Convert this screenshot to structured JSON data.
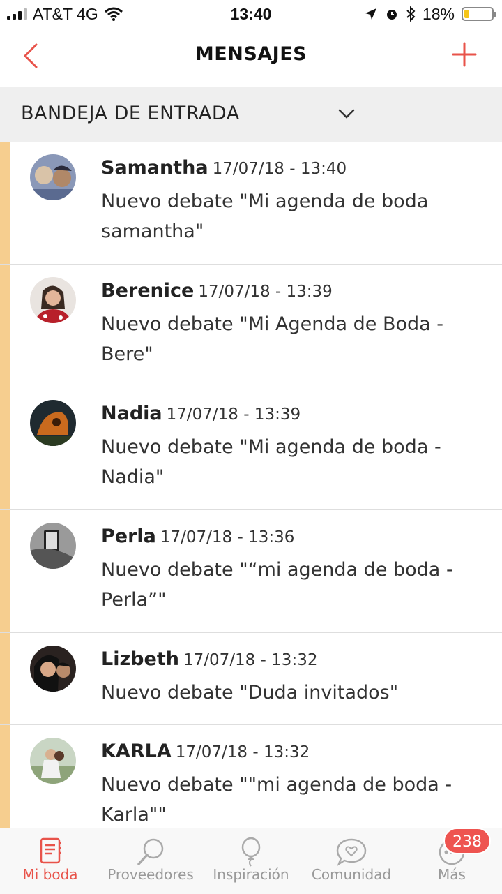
{
  "status_bar": {
    "carrier": "AT&T 4G",
    "time": "13:40",
    "battery": "18%",
    "battery_level": 0.18
  },
  "header": {
    "title": "MENSAJES",
    "back_icon": "chevron-left-icon",
    "add_icon": "plus-icon",
    "accent_color": "#e8534a"
  },
  "folder": {
    "label": "BANDEJA DE ENTRADA"
  },
  "messages": [
    {
      "name": "Samantha",
      "date": "17/07/18 - 13:40",
      "text": "Nuevo debate \"Mi agenda de boda samantha\""
    },
    {
      "name": "Berenice",
      "date": "17/07/18 - 13:39",
      "text": "Nuevo debate \"Mi Agenda de Boda - Bere\""
    },
    {
      "name": "Nadia",
      "date": "17/07/18 - 13:39",
      "text": "Nuevo debate \"Mi agenda de boda - Nadia\""
    },
    {
      "name": "Perla",
      "date": "17/07/18 - 13:36",
      "text": "Nuevo debate \"“mi agenda de boda - Perla”\""
    },
    {
      "name": "Lizbeth",
      "date": "17/07/18 - 13:32",
      "text": "Nuevo debate \"Duda invitados\""
    },
    {
      "name": "KARLA",
      "date": "17/07/18 - 13:32",
      "text": "Nuevo debate \"\"mi agenda de boda - Karla\"\""
    }
  ],
  "tabs": [
    {
      "label": "Mi boda",
      "icon": "planner-book-icon",
      "active": true
    },
    {
      "label": "Proveedores",
      "icon": "magnifier-icon",
      "active": false
    },
    {
      "label": "Inspiración",
      "icon": "balloon-icon",
      "active": false
    },
    {
      "label": "Comunidad",
      "icon": "chat-heart-icon",
      "active": false
    },
    {
      "label": "Más",
      "icon": "more-icon",
      "active": false
    }
  ],
  "more_badge": "238",
  "colors": {
    "unread_bar": "#f6ce8f",
    "folder_bg": "#efefef",
    "badge": "#ee5450"
  }
}
